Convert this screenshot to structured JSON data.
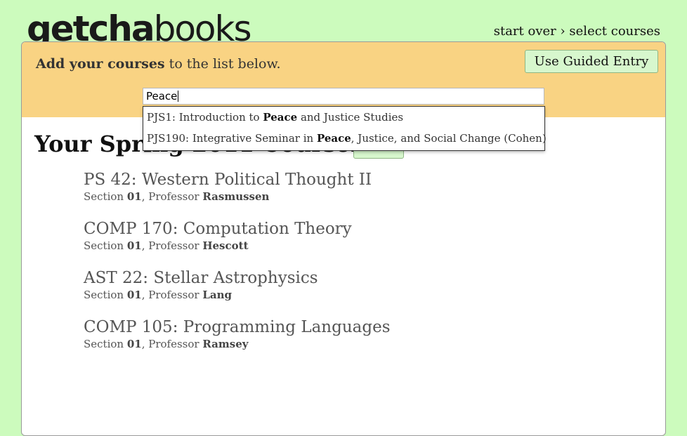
{
  "logo": {
    "part1": "getcha",
    "part2": "books"
  },
  "nav": {
    "start_over": "start over",
    "separator": "›",
    "select_courses": "select courses"
  },
  "header": {
    "add_bold": "Add your courses",
    "add_rest": " to the list below.",
    "guided_button": "Use Guided Entry"
  },
  "search": {
    "value": "Peace"
  },
  "autocomplete": [
    {
      "before": "PJS1: Introduction to ",
      "match": "Peace",
      "after": " and Justice Studies"
    },
    {
      "before": "PJS190: Integrative Seminar in ",
      "match": "Peace",
      "after": ", Justice, and Social Change (Cohen)"
    }
  ],
  "courses_heading": "Your Spring 2011 Courses",
  "courses": [
    {
      "title": "PS 42: Western Political Thought II",
      "section_label": "Section ",
      "section": "01",
      "prof_label": ", Professor ",
      "professor": "Rasmussen"
    },
    {
      "title": "COMP 170: Computation Theory",
      "section_label": "Section ",
      "section": "01",
      "prof_label": ", Professor ",
      "professor": "Hescott"
    },
    {
      "title": "AST 22: Stellar Astrophysics",
      "section_label": "Section ",
      "section": "01",
      "prof_label": ", Professor ",
      "professor": "Lang"
    },
    {
      "title": "COMP 105: Programming Languages",
      "section_label": "Section ",
      "section": "01",
      "prof_label": ", Professor ",
      "professor": "Ramsey"
    }
  ]
}
